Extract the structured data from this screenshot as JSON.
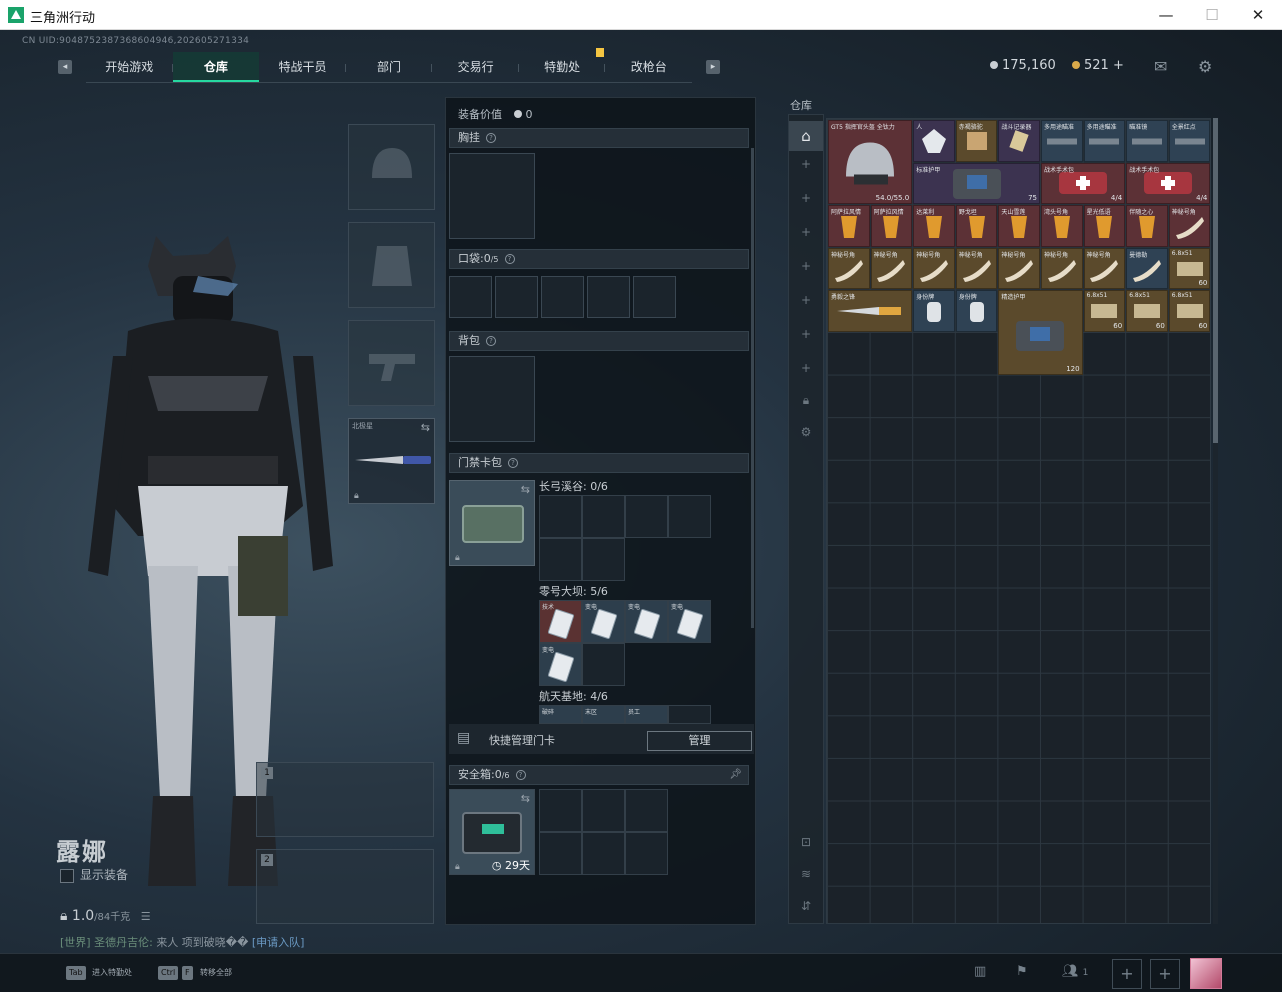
{
  "window": {
    "title": "三角洲行动",
    "min": "—",
    "max": "☐",
    "close": "✕"
  },
  "uid": "CN UID:9048752387368604946,202605271334",
  "nav": {
    "tabs": [
      {
        "label": "开始游戏",
        "active": false
      },
      {
        "label": "仓库",
        "active": true
      },
      {
        "label": "特战干员",
        "active": false
      },
      {
        "label": "部门",
        "active": false
      },
      {
        "label": "交易行",
        "active": false
      },
      {
        "label": "特勤处",
        "active": false
      },
      {
        "label": "改枪台",
        "active": false
      }
    ],
    "left_arrow": "◂",
    "right_arrow": "▸"
  },
  "currency": {
    "silver": "175,160",
    "gold": "521 +"
  },
  "character": {
    "name": "露娜",
    "show_equip": "显示装备",
    "weight": "1.0",
    "weight_max": "/84千克",
    "chat_channel": "[世界]",
    "chat_user": "圣德丹吉伦:",
    "chat_msg": "来人 项到破晓��",
    "chat_link": "[申请入队]"
  },
  "melee": {
    "label": "北极星"
  },
  "gunslots": [
    "1",
    "2"
  ],
  "loadout": {
    "title": "装备价值",
    "value": "0",
    "chest": "胸挂",
    "pocket_label": "口袋:",
    "pocket_count": "0",
    "pocket_max": "/5",
    "backpack": "背包",
    "keycard_pack": "门禁卡包",
    "maps": [
      {
        "name": "长弓溪谷: 0/6"
      },
      {
        "name": "零号大坝: 5/6"
      },
      {
        "name": "航天基地: 4/6"
      }
    ],
    "dam_cards": [
      "技术",
      "变电",
      "变电",
      "变电",
      "变电"
    ],
    "space_cards": [
      "破碎",
      "末区",
      "员工"
    ],
    "quick_manage": "快捷管理门卡",
    "manage_btn": "管理",
    "safebox_label": "安全箱:",
    "safebox_count": "0",
    "safebox_max": "/6",
    "safebox_days": "29天"
  },
  "stash": {
    "title": "仓库",
    "items": [
      {
        "name": "GT5 指挥官头盔 全钛力",
        "count": "54.0/55.0",
        "color": "c-red",
        "glyph": "helmet-icon"
      },
      {
        "name": "人",
        "count": "",
        "color": "c-purp",
        "glyph": "crystal-icon"
      },
      {
        "name": "赤褐骆驼",
        "count": "",
        "color": "c-gold",
        "glyph": "box-icon"
      },
      {
        "name": "战斗记录器",
        "count": "",
        "color": "c-purp",
        "glyph": "tool-icon"
      },
      {
        "name": "多用途瞄准",
        "count": "",
        "color": "c-blue",
        "glyph": "scope-icon"
      },
      {
        "name": "多用途瞄准",
        "count": "",
        "color": "c-blue",
        "glyph": "scope-icon"
      },
      {
        "name": "瞄准镜",
        "count": "",
        "color": "c-blue",
        "glyph": "scope-icon"
      },
      {
        "name": "全景红点",
        "count": "",
        "color": "c-blue",
        "glyph": "scope-icon"
      },
      {
        "name": "标准护甲",
        "count": "75",
        "color": "c-purp",
        "glyph": "armor-icon"
      },
      {
        "name": "战术手术包",
        "count": "4/4",
        "color": "c-red",
        "glyph": "medkit-icon"
      },
      {
        "name": "战术手术包",
        "count": "4/4",
        "color": "c-red",
        "glyph": "medkit-icon"
      },
      {
        "name": "阿萨拉风情",
        "count": "",
        "color": "c-red",
        "glyph": "drink-icon"
      },
      {
        "name": "阿萨拉风情",
        "count": "",
        "color": "c-red",
        "glyph": "drink-icon"
      },
      {
        "name": "达莱利",
        "count": "",
        "color": "c-red",
        "glyph": "drink-icon"
      },
      {
        "name": "野戈坦",
        "count": "",
        "color": "c-red",
        "glyph": "drink-icon"
      },
      {
        "name": "天山雪莲",
        "count": "",
        "color": "c-red",
        "glyph": "drink-icon"
      },
      {
        "name": "湾头号角",
        "count": "",
        "color": "c-red",
        "glyph": "drink-icon"
      },
      {
        "name": "星光低语",
        "count": "",
        "color": "c-red",
        "glyph": "drink-icon"
      },
      {
        "name": "伴随之心",
        "count": "",
        "color": "c-red",
        "glyph": "drink-icon"
      },
      {
        "name": "神秘号角",
        "count": "",
        "color": "c-red",
        "glyph": "horn-icon"
      },
      {
        "name": "神秘号角",
        "count": "",
        "color": "c-gold",
        "glyph": "horn-icon"
      },
      {
        "name": "神秘号角",
        "count": "",
        "color": "c-gold",
        "glyph": "horn-icon"
      },
      {
        "name": "神秘号角",
        "count": "",
        "color": "c-gold",
        "glyph": "horn-icon"
      },
      {
        "name": "神秘号角",
        "count": "",
        "color": "c-gold",
        "glyph": "horn-icon"
      },
      {
        "name": "神秘号角",
        "count": "",
        "color": "c-gold",
        "glyph": "horn-icon"
      },
      {
        "name": "神秘号角",
        "count": "",
        "color": "c-gold",
        "glyph": "horn-icon"
      },
      {
        "name": "神秘号角",
        "count": "",
        "color": "c-gold",
        "glyph": "horn-icon"
      },
      {
        "name": "曼德勒",
        "count": "",
        "color": "c-blue",
        "glyph": "horn-icon"
      },
      {
        "name": "6.8x51",
        "count": "60",
        "color": "c-gold",
        "glyph": "ammo-icon"
      },
      {
        "name": "勇毅之锋",
        "count": "",
        "color": "c-gold",
        "glyph": "knife-icon"
      },
      {
        "name": "身份牌",
        "count": "",
        "color": "c-blue",
        "glyph": "tag-icon"
      },
      {
        "name": "身份牌",
        "count": "",
        "color": "c-blue",
        "glyph": "tag-icon"
      },
      {
        "name": "精造护甲",
        "count": "120",
        "color": "c-gold",
        "glyph": "armor-icon"
      },
      {
        "name": "6.8x51",
        "count": "60",
        "color": "c-gold",
        "glyph": "ammo-icon"
      },
      {
        "name": "6.8x51",
        "count": "60",
        "color": "c-gold",
        "glyph": "ammo-icon"
      },
      {
        "name": "6.8x51",
        "count": "60",
        "color": "c-gold",
        "glyph": "ammo-icon"
      }
    ]
  },
  "bottom": {
    "k1": "Tab",
    "t1": "进入特勤处",
    "k2": "Ctrl",
    "k2b": "F",
    "t2": "转移全部",
    "friends": "1"
  },
  "colors": {
    "accent": "#26d8a0",
    "bg": "#1b2229"
  }
}
